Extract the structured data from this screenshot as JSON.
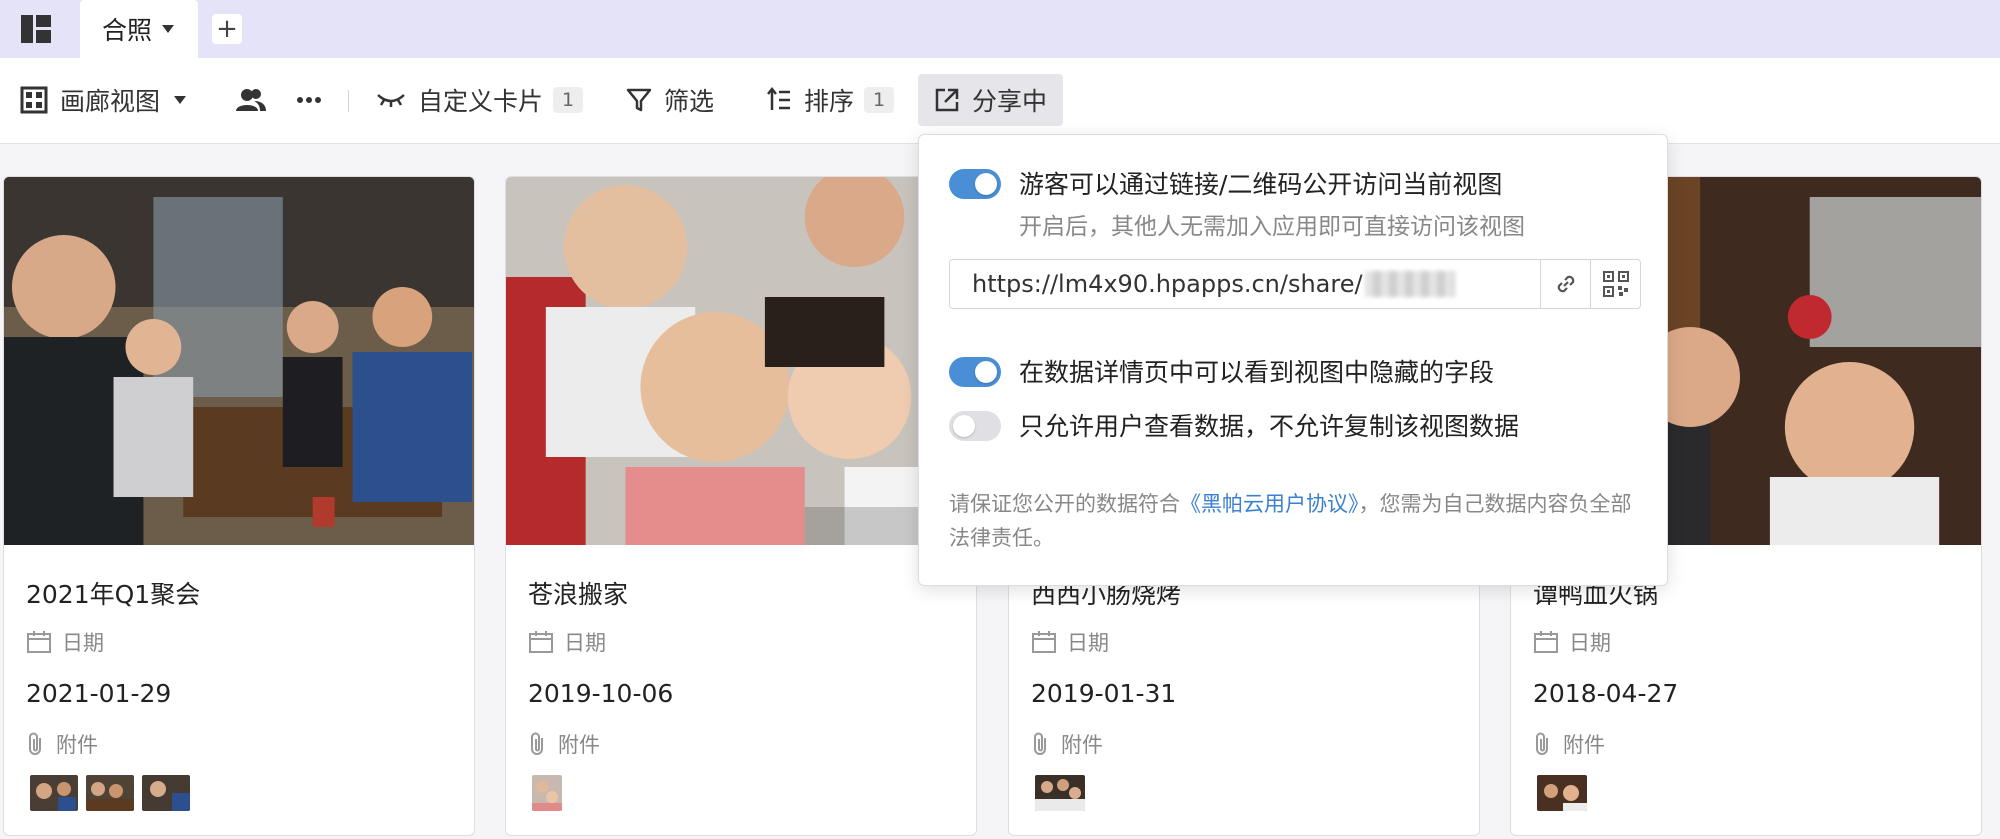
{
  "tabs": [
    {
      "label": "合照"
    }
  ],
  "toolbar": {
    "view_label": "画廊视图",
    "custom_card_label": "自定义卡片",
    "custom_card_count": "1",
    "filter_label": "筛选",
    "sort_label": "排序",
    "sort_count": "1",
    "share_label": "分享中"
  },
  "cards": [
    {
      "title": "2021年Q1聚会",
      "date_label": "日期",
      "date": "2021-01-29",
      "attach_label": "附件"
    },
    {
      "title": "苍浪搬家",
      "date_label": "日期",
      "date": "2019-10-06",
      "attach_label": "附件"
    },
    {
      "title": "西西小肠烧烤",
      "date_label": "日期",
      "date": "2019-01-31",
      "attach_label": "附件"
    },
    {
      "title": "谭鸭血火锅",
      "date_label": "日期",
      "date": "2018-04-27",
      "attach_label": "附件"
    }
  ],
  "share_popup": {
    "public_access": {
      "label": "游客可以通过链接/二维码公开访问当前视图",
      "sub": "开启后，其他人无需加入应用即可直接访问该视图",
      "enabled": true
    },
    "link_url": "https://lm4x90.hpapps.cn/share/",
    "hidden_fields": {
      "label": "在数据详情页中可以看到视图中隐藏的字段",
      "enabled": true
    },
    "view_only": {
      "label": "只允许用户查看数据，不允许复制该视图数据",
      "enabled": false
    },
    "notice_before": "请保证您公开的数据符合",
    "notice_link": "《黑帕云用户协议》",
    "notice_after": "，您需为自己数据内容负全部法律责任。"
  },
  "colors": {
    "accent": "#4a8fd6",
    "topbar": "#e4e3f7",
    "link": "#3a80d2"
  }
}
